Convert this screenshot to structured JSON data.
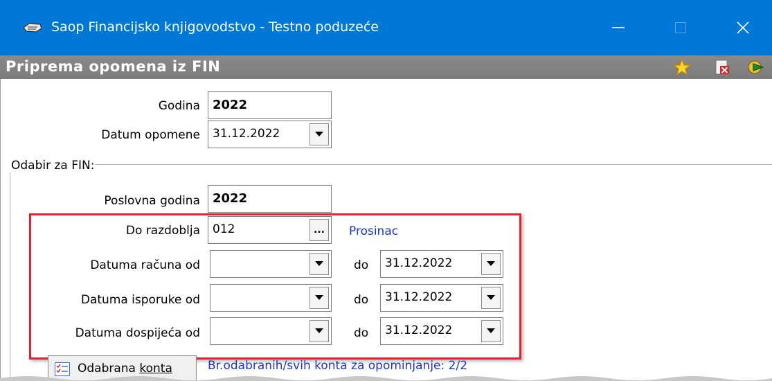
{
  "window": {
    "title": "Saop Financijsko knjigovodstvo - Testno poduzeće",
    "controls": {
      "minimize": "—",
      "maximize": "☐",
      "close": "✕"
    }
  },
  "ribbon": {
    "page_title": "Priprema opomena iz FIN",
    "tools": [
      "star-icon",
      "cancel-doc-icon",
      "run-icon"
    ]
  },
  "form": {
    "godina": {
      "label": "Godina",
      "value": "2022"
    },
    "datum_opomene": {
      "label": "Datum opomene",
      "value": "31.12.2022"
    },
    "group_legend": "Odabir za FIN:",
    "poslovna_godina": {
      "label": "Poslovna godina",
      "value": "2022"
    },
    "do_razdoblja": {
      "label": "Do razdoblja",
      "value": "012",
      "button": "...",
      "resolved": "Prosinac"
    },
    "datuma_racuna": {
      "label": "Datuma računa od",
      "from": "",
      "to_label": "do",
      "to": "31.12.2022"
    },
    "datuma_isporuke": {
      "label": "Datuma isporuke od",
      "from": "",
      "to_label": "do",
      "to": "31.12.2022"
    },
    "datuma_dospijeca": {
      "label": "Datuma dospijeća od",
      "from": "",
      "to_label": "do",
      "to": "31.12.2022"
    },
    "odabrana_konta": {
      "label_prefix": "Odabrana ",
      "label_underlined": "konta"
    },
    "konta_info": "Br.odabranih/svih konta za opominjanje: 2/2"
  },
  "colors": {
    "titlebar": "#0078d7",
    "ribbon": "#808080",
    "highlight": "#e5202a",
    "link_blue": "#1a36c8"
  }
}
